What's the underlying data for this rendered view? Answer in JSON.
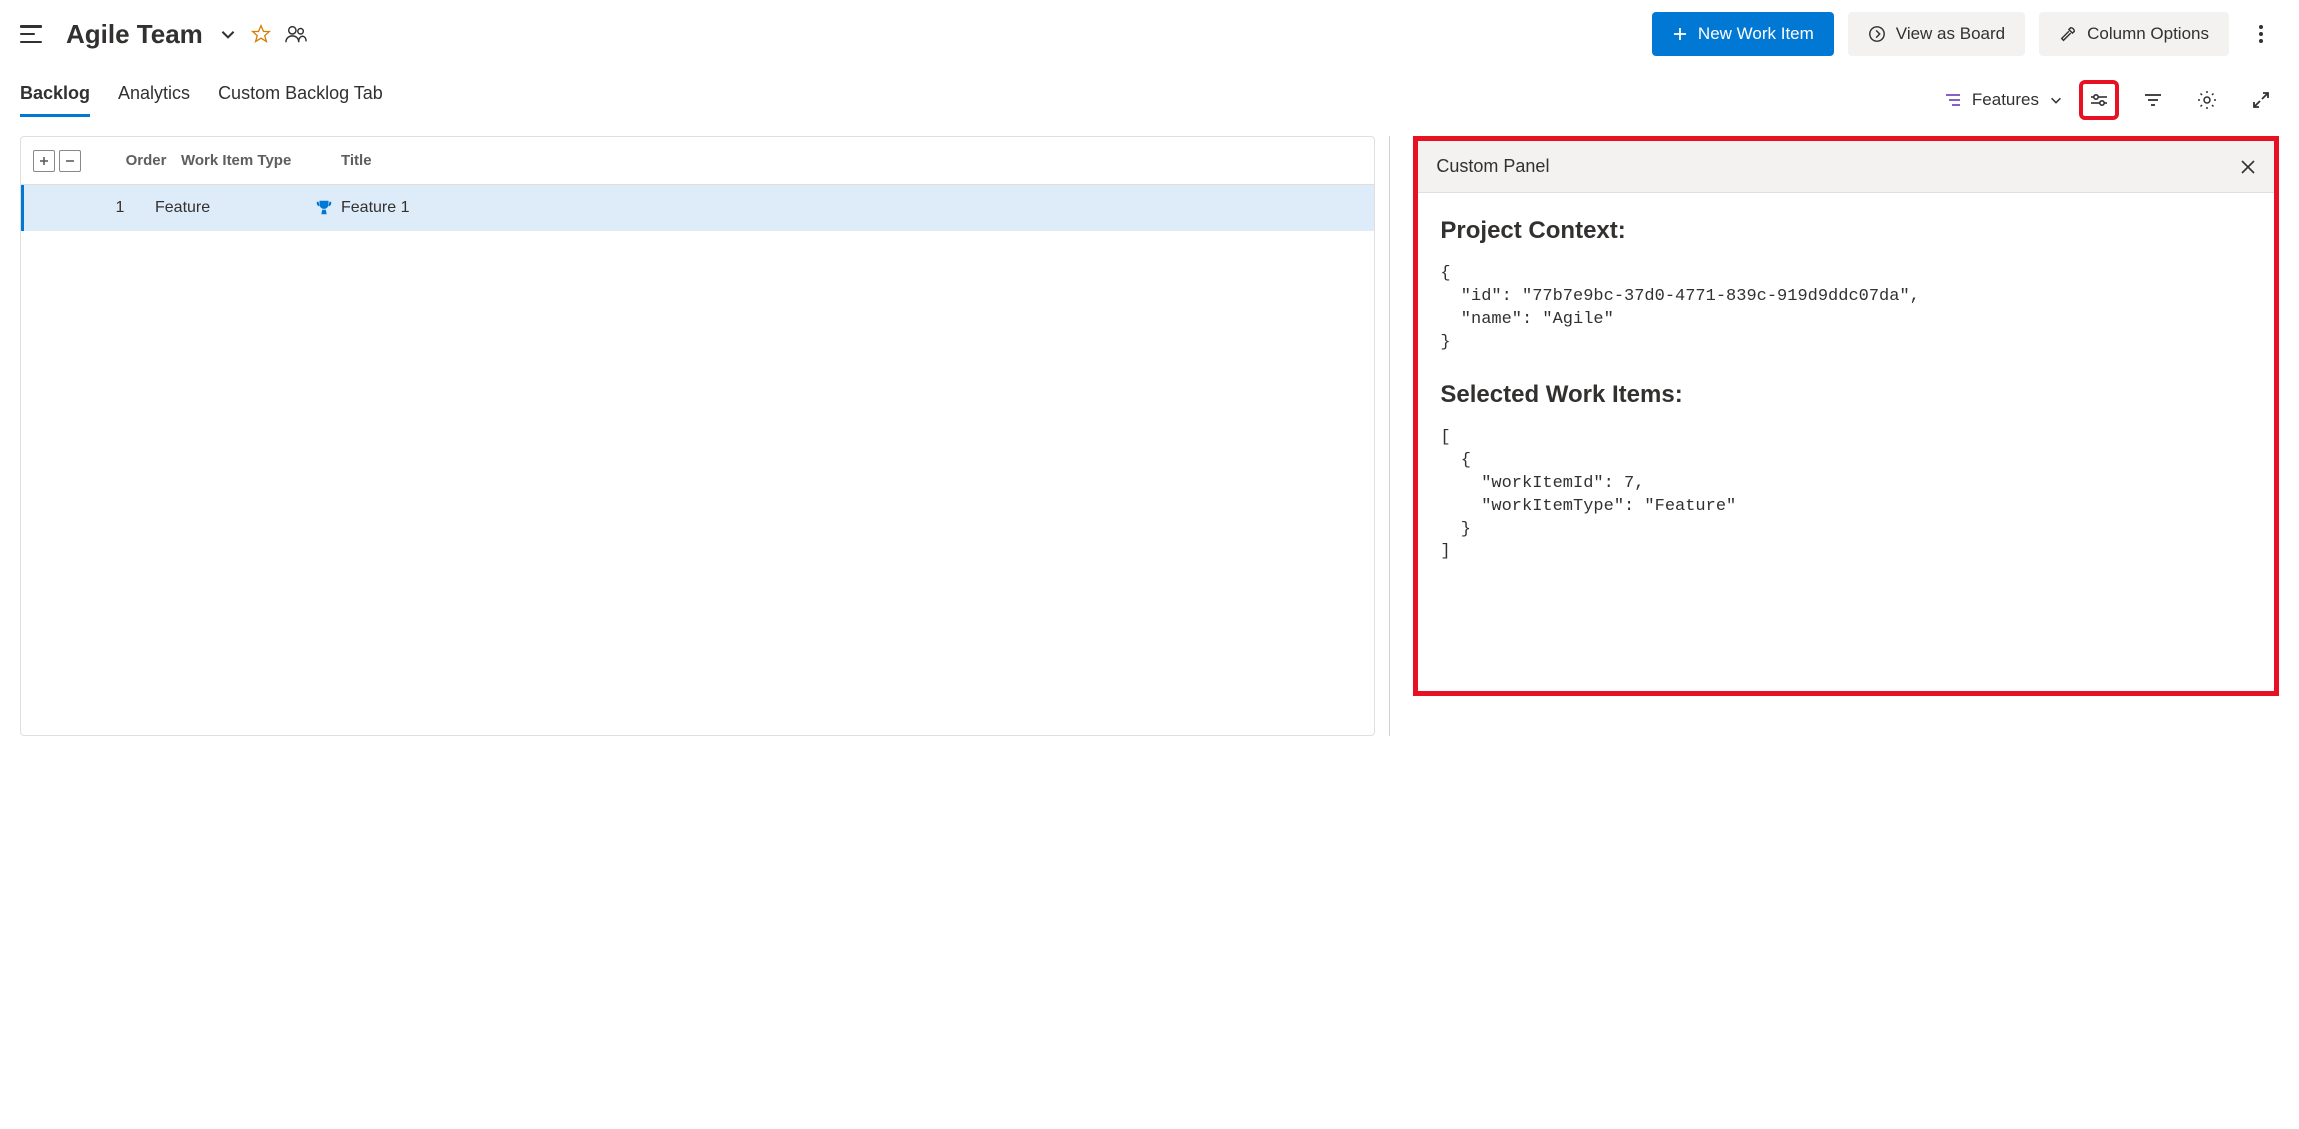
{
  "header": {
    "team_name": "Agile Team",
    "new_work_item_label": "New Work Item",
    "view_as_board_label": "View as Board",
    "column_options_label": "Column Options"
  },
  "tabs": {
    "items": [
      "Backlog",
      "Analytics",
      "Custom Backlog Tab"
    ],
    "active_index": 0
  },
  "backlog_level": {
    "label": "Features"
  },
  "grid": {
    "columns": {
      "order": "Order",
      "type": "Work Item Type",
      "title": "Title"
    },
    "rows": [
      {
        "order": "1",
        "type": "Feature",
        "title": "Feature 1",
        "selected": true
      }
    ]
  },
  "panel": {
    "title": "Custom Panel",
    "project_heading": "Project Context:",
    "project_json": "{\n  \"id\": \"77b7e9bc-37d0-4771-839c-919d9ddc07da\",\n  \"name\": \"Agile\"\n}",
    "selected_heading": "Selected Work Items:",
    "selected_json": "[\n  {\n    \"workItemId\": 7,\n    \"workItemType\": \"Feature\"\n  }\n]"
  }
}
